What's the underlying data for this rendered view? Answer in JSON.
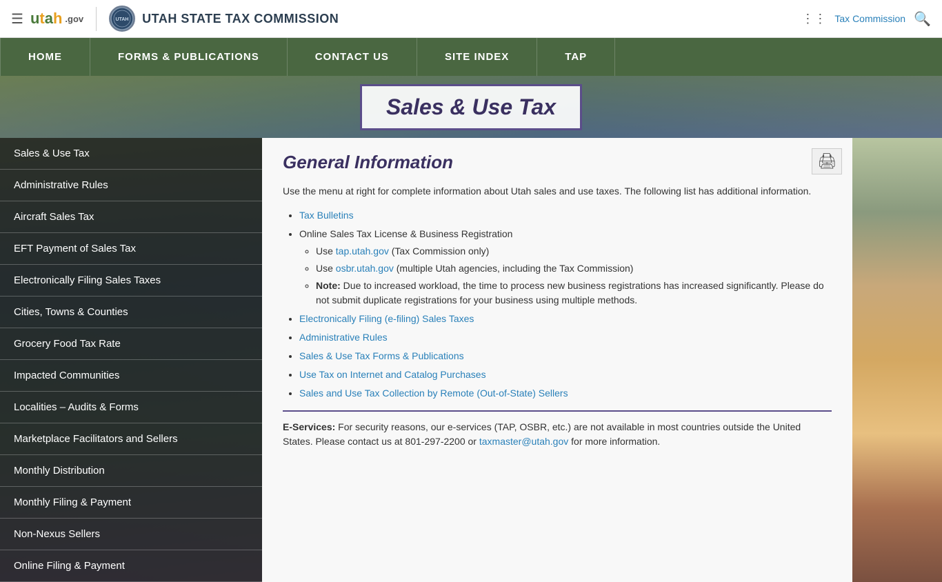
{
  "topbar": {
    "menu_label": "Menu",
    "utah_text": "utah",
    "gov_text": ".gov",
    "agency_title": "UTAH STATE TAX COMMISSION",
    "tax_commission_link": "Tax Commission"
  },
  "nav": {
    "items": [
      {
        "label": "HOME",
        "id": "home"
      },
      {
        "label": "FORMS & PUBLICATIONS",
        "id": "forms"
      },
      {
        "label": "CONTACT US",
        "id": "contact"
      },
      {
        "label": "SITE INDEX",
        "id": "site-index"
      },
      {
        "label": "TAP",
        "id": "tap"
      }
    ]
  },
  "hero": {
    "title": "Sales & Use Tax"
  },
  "sidebar": {
    "items": [
      {
        "label": "Sales & Use Tax",
        "id": "sales-use-tax",
        "active": true
      },
      {
        "label": "Administrative Rules",
        "id": "admin-rules"
      },
      {
        "label": "Aircraft Sales Tax",
        "id": "aircraft-sales-tax"
      },
      {
        "label": "EFT Payment of Sales Tax",
        "id": "eft-payment"
      },
      {
        "label": "Electronically Filing Sales Taxes",
        "id": "e-filing"
      },
      {
        "label": "Cities, Towns & Counties",
        "id": "cities-towns"
      },
      {
        "label": "Grocery Food Tax Rate",
        "id": "grocery-food"
      },
      {
        "label": "Impacted Communities",
        "id": "impacted-communities"
      },
      {
        "label": "Localities – Audits & Forms",
        "id": "localities"
      },
      {
        "label": "Marketplace Facilitators and Sellers",
        "id": "marketplace"
      },
      {
        "label": "Monthly Distribution",
        "id": "monthly-dist"
      },
      {
        "label": "Monthly Filing & Payment",
        "id": "monthly-filing"
      },
      {
        "label": "Non-Nexus Sellers",
        "id": "non-nexus"
      },
      {
        "label": "Online Filing & Payment",
        "id": "online-filing"
      }
    ]
  },
  "content": {
    "title": "General Information",
    "intro": "Use the menu at right for complete information about Utah sales and use taxes. The following list has additional information.",
    "list_items": [
      {
        "text": "Tax Bulletins",
        "link": true,
        "id": "tax-bulletins"
      },
      {
        "text": "Online Sales Tax License & Business Registration",
        "link": false,
        "id": "online-reg",
        "sub_items": [
          {
            "text": "Use tap.utah.gov (Tax Commission only)",
            "link_text": "tap.utah.gov",
            "link": true
          },
          {
            "text": "Use osbr.utah.gov (multiple Utah agencies, including the Tax Commission)",
            "link_text": "osbr.utah.gov",
            "link": true
          },
          {
            "text": "Note: Due to increased workload, the time to process new business registrations has increased significantly. Please do not submit duplicate registrations for your business using multiple methods.",
            "bold_prefix": "Note:",
            "link": false
          }
        ]
      },
      {
        "text": "Electronically Filing (e-filing) Sales Taxes",
        "link": true,
        "id": "e-filing-link"
      },
      {
        "text": "Administrative Rules",
        "link": true,
        "id": "admin-rules-link"
      },
      {
        "text": "Sales & Use Tax Forms & Publications",
        "link": true,
        "id": "forms-link"
      },
      {
        "text": "Use Tax on Internet and Catalog Purchases",
        "link": true,
        "id": "use-tax-link"
      },
      {
        "text": "Sales and Use Tax Collection by Remote (Out-of-State) Sellers",
        "link": true,
        "id": "remote-sellers-link"
      }
    ],
    "e_services_bold": "E-Services:",
    "e_services_text": " For security reasons, our e-services (TAP, OSBR, etc.) are not available in most countries outside the United States. Please contact us at 801-297-2200 or ",
    "e_services_email": "taxmaster@utah.gov",
    "e_services_suffix": " for more information."
  }
}
